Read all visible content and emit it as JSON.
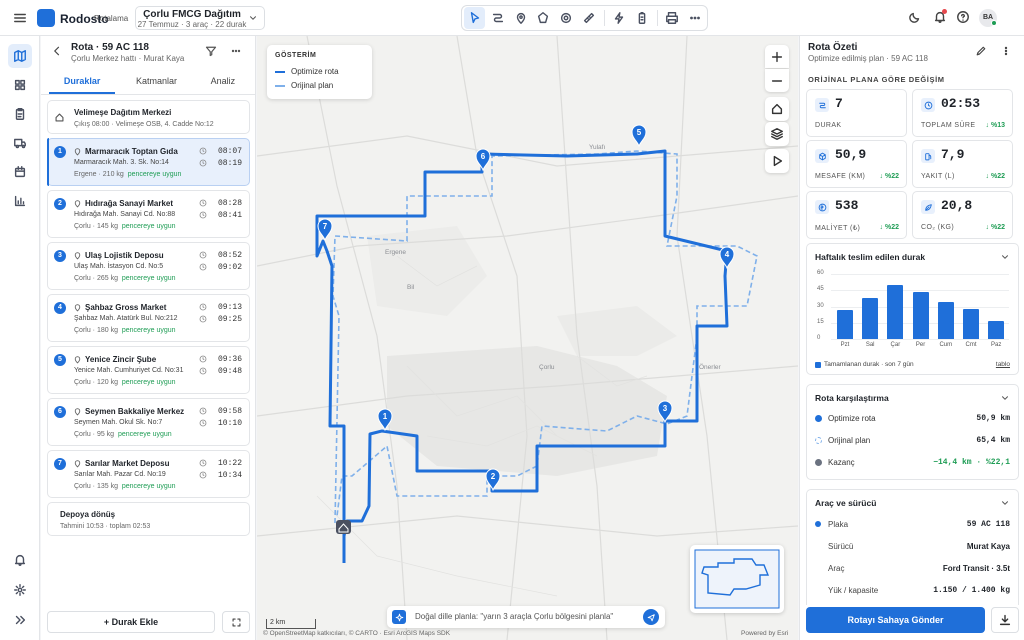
{
  "app": {
    "brand": "Rodosto",
    "brand_sub": "Rotalama",
    "project_name": "Çorlu FMCG Dağıtım",
    "project_meta": "27 Temmuz · 3 araç · 22 durak",
    "avatar": "BA"
  },
  "toolbar": {
    "tools": [
      "cursor-icon",
      "route-icon",
      "pin-icon",
      "polygon-icon",
      "target-icon",
      "ruler-icon",
      "lightning-icon",
      "battery-icon",
      "print-icon",
      "more-icon"
    ]
  },
  "route": {
    "title": "Rota · 59 AC 118",
    "subtitle": "Çorlu Merkez hattı · Murat Kaya",
    "tabs": [
      {
        "label": "Duraklar"
      },
      {
        "label": "Katmanlar"
      },
      {
        "label": "Analiz"
      }
    ],
    "start": {
      "name": "Velimeşe Dağıtım Merkezi",
      "detail": "Çıkış 08:00 · Velimeşe OSB, 4. Cadde No:12"
    },
    "stops": [
      {
        "n": "1",
        "name": "Marmaracık Toptan Gıda",
        "addr": "Marmaracık Mah. 3. Sk. No:14",
        "load": "Ergene · 210 kg",
        "status": "pencereye uygun",
        "t1": "08:07",
        "t2": "08:19"
      },
      {
        "n": "2",
        "name": "Hıdırağa Sanayi Market",
        "addr": "Hıdırağa Mah. Sanayi Cd. No:88",
        "load": "Çorlu · 145 kg",
        "status": "pencereye uygun",
        "t1": "08:28",
        "t2": "08:41"
      },
      {
        "n": "3",
        "name": "Ulaş Lojistik Deposu",
        "addr": "Ulaş Mah. İstasyon Cd. No:5",
        "load": "Çorlu · 265 kg",
        "status": "pencereye uygun",
        "t1": "08:52",
        "t2": "09:02"
      },
      {
        "n": "4",
        "name": "Şahbaz Gross Market",
        "addr": "Şahbaz Mah. Atatürk Bul. No:212",
        "load": "Çorlu · 180 kg",
        "status": "pencereye uygun",
        "t1": "09:13",
        "t2": "09:25"
      },
      {
        "n": "5",
        "name": "Yenice Zincir Şube",
        "addr": "Yenice Mah. Cumhuriyet Cd. No:31",
        "load": "Çorlu · 120 kg",
        "status": "pencereye uygun",
        "t1": "09:36",
        "t2": "09:48"
      },
      {
        "n": "6",
        "name": "Seymen Bakkaliye Merkez",
        "addr": "Seymen Mah. Okul Sk. No:7",
        "load": "Çorlu · 95 kg",
        "status": "pencereye uygun",
        "t1": "09:58",
        "t2": "10:10"
      },
      {
        "n": "7",
        "name": "Sarılar Market Deposu",
        "addr": "Sarılar Mah. Pazar Cd. No:19",
        "load": "Çorlu · 135 kg",
        "status": "pencereye uygun",
        "t1": "10:22",
        "t2": "10:34"
      }
    ],
    "end": {
      "name": "Depoya dönüş",
      "detail": "Tahmini 10:53 · toplam 02:53"
    },
    "add_label": "Durak Ekle"
  },
  "map": {
    "legend_title": "GÖSTERİM",
    "legend_optimized": "Optimize rota",
    "legend_original": "Orijinal plan",
    "places": [
      "Yulafı",
      "Ergene",
      "Bil",
      "Çorlu",
      "Önerler"
    ],
    "nl_placeholder": "Doğal dille planla: \"yarın 3 araçla Çorlu bölgesini planla\"",
    "scale": "2 km",
    "attribution": "© OpenStreetMap katkıcıları, © CARTO · Esri ArcGIS Maps SDK",
    "powered": "Powered by Esri"
  },
  "summary": {
    "title": "Rota Özeti",
    "subtitle": "Optimize edilmiş plan · 59 AC 118",
    "section": "ORİJİNAL PLANA GÖRE DEĞİŞİM",
    "kpis": [
      {
        "value": "7",
        "label": "DURAK",
        "delta": "",
        "icon": "route-icon"
      },
      {
        "value": "02:53",
        "label": "TOPLAM SÜRE",
        "delta": "↓ %13",
        "icon": "clock-icon"
      },
      {
        "value": "50,9",
        "label": "MESAFE (KM)",
        "delta": "↓ %22",
        "icon": "box-icon"
      },
      {
        "value": "7,9",
        "label": "YAKIT (L)",
        "delta": "↓ %22",
        "icon": "fuel-icon"
      },
      {
        "value": "538",
        "label": "MALİYET (₺)",
        "delta": "↓ %22",
        "icon": "lira-icon"
      },
      {
        "value": "20,8",
        "label": "CO₂ (KG)",
        "delta": "↓ %22",
        "icon": "leaf-icon"
      }
    ],
    "chart_title": "Haftalık teslim edilen durak",
    "chart_note": "Tamamlanan durak · son 7 gün",
    "chart_table": "tablo",
    "compare_title": "Rota karşılaştırma",
    "compare": [
      {
        "label": "Optimize rota",
        "value": "50,9 km",
        "color": "#1f6fd9"
      },
      {
        "label": "Orijinal plan",
        "value": "65,4 km",
        "color": "#7fb0ea"
      },
      {
        "label": "Kazanç",
        "value": "−14,4 km · %22,1",
        "color": "#6b7280"
      }
    ],
    "vehicle_title": "Araç ve sürücü",
    "vehicle": [
      {
        "label": "Plaka",
        "value": "59 AC 118"
      },
      {
        "label": "Sürücü",
        "value": "Murat Kaya"
      },
      {
        "label": "Araç",
        "value": "Ford Transit · 3.5t"
      },
      {
        "label": "Yük / kapasite",
        "value": "1.150 / 1.400 kg"
      }
    ],
    "send_label": "Rotayı Sahaya Gönder"
  },
  "chart_data": {
    "type": "bar",
    "title": "Haftalık teslim edilen durak",
    "categories": [
      "Pzt",
      "Sal",
      "Çar",
      "Per",
      "Cum",
      "Cmt",
      "Paz"
    ],
    "values": [
      27,
      38,
      50,
      43,
      34,
      28,
      17
    ],
    "ylim": [
      0,
      50
    ],
    "yticks": [
      0,
      15,
      30,
      45,
      60
    ],
    "ytick_labels": [
      "0",
      "15",
      "30",
      "45",
      "60"
    ],
    "grid": true,
    "legend": "bottom"
  },
  "colors": {
    "accent": "#1f6fd9",
    "original": "#7fb0ea",
    "good": "#1f9d55"
  }
}
